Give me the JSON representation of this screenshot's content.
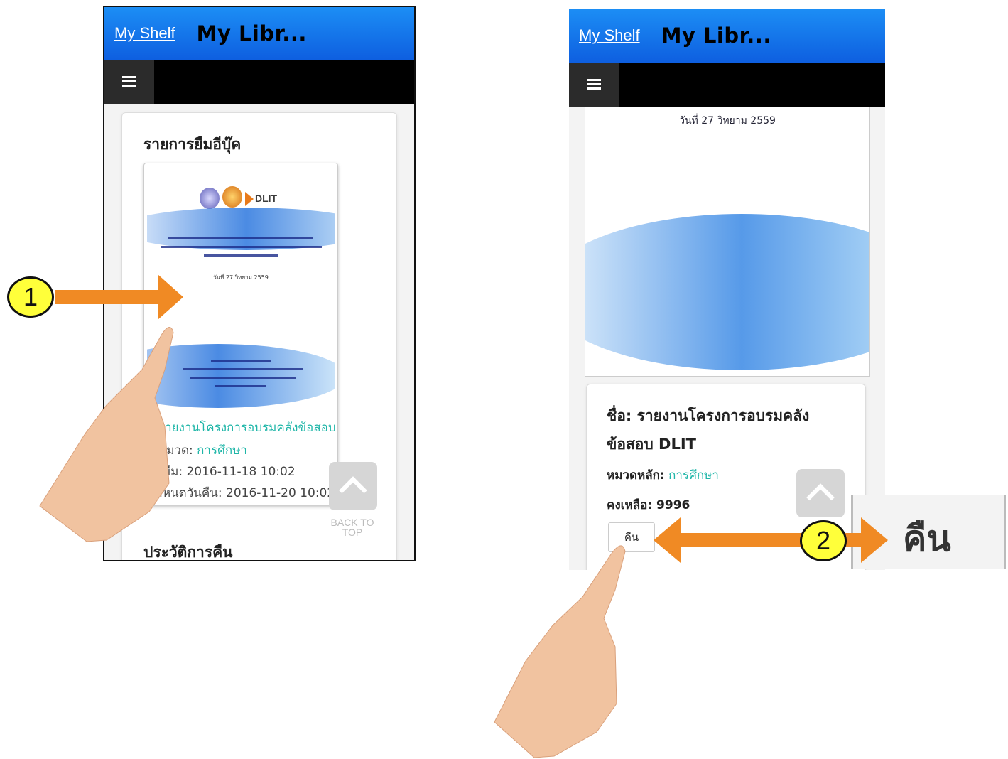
{
  "colors": {
    "appbar": "#1477ea",
    "navbar": "#000000",
    "accent_teal": "#1fb6a8",
    "arrow": "#f08a24",
    "step_badge": "#ffff3a"
  },
  "phone1": {
    "shelf_link": "My Shelf",
    "app_title": "My Libr...",
    "menu_icon": "hamburger-icon",
    "borrow_heading": "รายการยืมอีบุ๊ค",
    "cover_brand": "DLIT",
    "cover_date": "วันที่ 27 วิทยาม 2559",
    "book_title": "รายงานโครงการอบรมคลังข้อสอบ",
    "category_label": "หมวด:",
    "category_value": "การศึกษา",
    "borrow_date": "วันยืม: 2016-11-18 10:02",
    "due_date": "กำหนดวันคืน: 2016-11-20 10:02",
    "back_to_top": "BACK TO TOP",
    "history_heading": "ประวัติการคืน"
  },
  "phone2": {
    "shelf_link": "My Shelf",
    "app_title": "My Libr...",
    "menu_icon": "hamburger-icon",
    "cover_date": "วันที่ 27 วิทยาม 2559",
    "detail_title": "ชื่อ: รายงานโครงการอบรมคลังข้อสอบ DLIT",
    "category_label": "หมวดหลัก:",
    "category_value": "การศึกษา",
    "remaining": "คงเหลือ: 9996",
    "return_button": "คืน"
  },
  "callout": {
    "step1": "1",
    "step2": "2",
    "zoom_label": "คืน"
  }
}
